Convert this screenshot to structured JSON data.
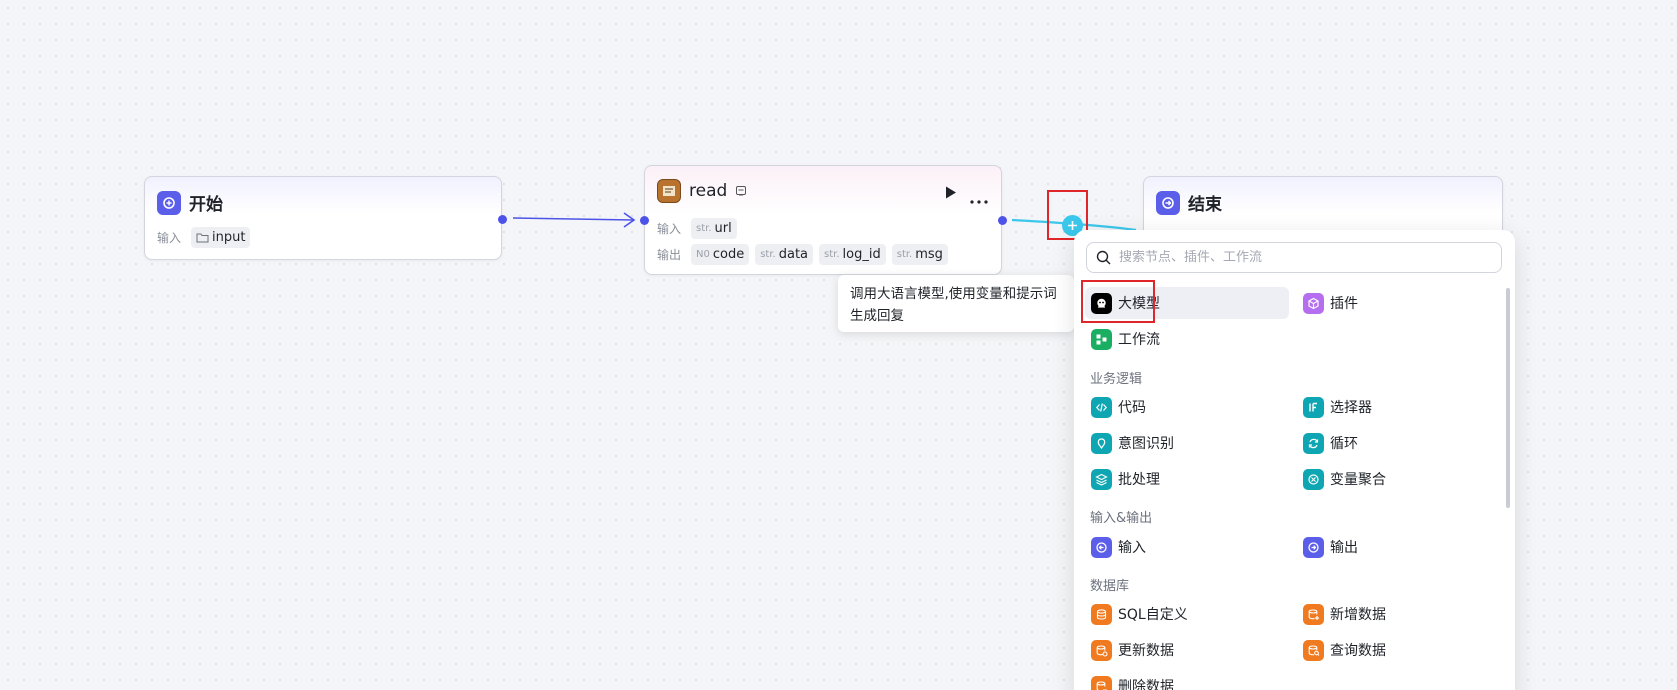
{
  "canvas": {
    "start_node": {
      "title": "开始",
      "input_label": "输入",
      "input_var": "input"
    },
    "read_node": {
      "title": "read",
      "input_label": "输入",
      "output_label": "输出",
      "inputs": [
        {
          "type": "str.",
          "name": "url"
        }
      ],
      "outputs": [
        {
          "type": "N0",
          "name": "code"
        },
        {
          "type": "str.",
          "name": "data"
        },
        {
          "type": "str.",
          "name": "log_id"
        },
        {
          "type": "str.",
          "name": "msg"
        }
      ]
    },
    "end_node": {
      "title": "结束"
    }
  },
  "tooltip": {
    "text_line1": "调用大语言模型,使用变量和提示词",
    "text_line2": "生成回复"
  },
  "node_panel": {
    "search_placeholder": "搜索节点、插件、工作流",
    "top_items": [
      {
        "label": "大模型",
        "icon": "llm-icon",
        "color": "#000000"
      },
      {
        "label": "插件",
        "icon": "plugin-icon",
        "color": "#b56ef0"
      },
      {
        "label": "工作流",
        "icon": "workflow-icon",
        "color": "#1aae62"
      }
    ],
    "sections": [
      {
        "title": "业务逻辑",
        "items": [
          {
            "label": "代码",
            "icon": "code-icon",
            "color": "#0fa6b3"
          },
          {
            "label": "选择器",
            "icon": "if-icon",
            "color": "#0fa6b3"
          },
          {
            "label": "意图识别",
            "icon": "intent-icon",
            "color": "#0fa6b3"
          },
          {
            "label": "循环",
            "icon": "loop-icon",
            "color": "#0fa6b3"
          },
          {
            "label": "批处理",
            "icon": "batch-icon",
            "color": "#0fa6b3"
          },
          {
            "label": "变量聚合",
            "icon": "aggregate-icon",
            "color": "#0fa6b3"
          }
        ]
      },
      {
        "title": "输入&输出",
        "items": [
          {
            "label": "输入",
            "icon": "input-icon",
            "color": "#5b5ee8"
          },
          {
            "label": "输出",
            "icon": "output-icon",
            "color": "#5b5ee8"
          }
        ]
      },
      {
        "title": "数据库",
        "items": [
          {
            "label": "SQL自定义",
            "icon": "sql-icon",
            "color": "#f07a1f"
          },
          {
            "label": "新增数据",
            "icon": "db-add-icon",
            "color": "#f07a1f"
          },
          {
            "label": "更新数据",
            "icon": "db-update-icon",
            "color": "#f07a1f"
          },
          {
            "label": "查询数据",
            "icon": "db-query-icon",
            "color": "#f07a1f"
          },
          {
            "label": "删除数据",
            "icon": "db-delete-icon",
            "color": "#f07a1f"
          }
        ]
      }
    ]
  },
  "colors": {
    "accent": "#4d53e8",
    "highlight": "#e0262b",
    "connector": "#3bc7eb"
  }
}
